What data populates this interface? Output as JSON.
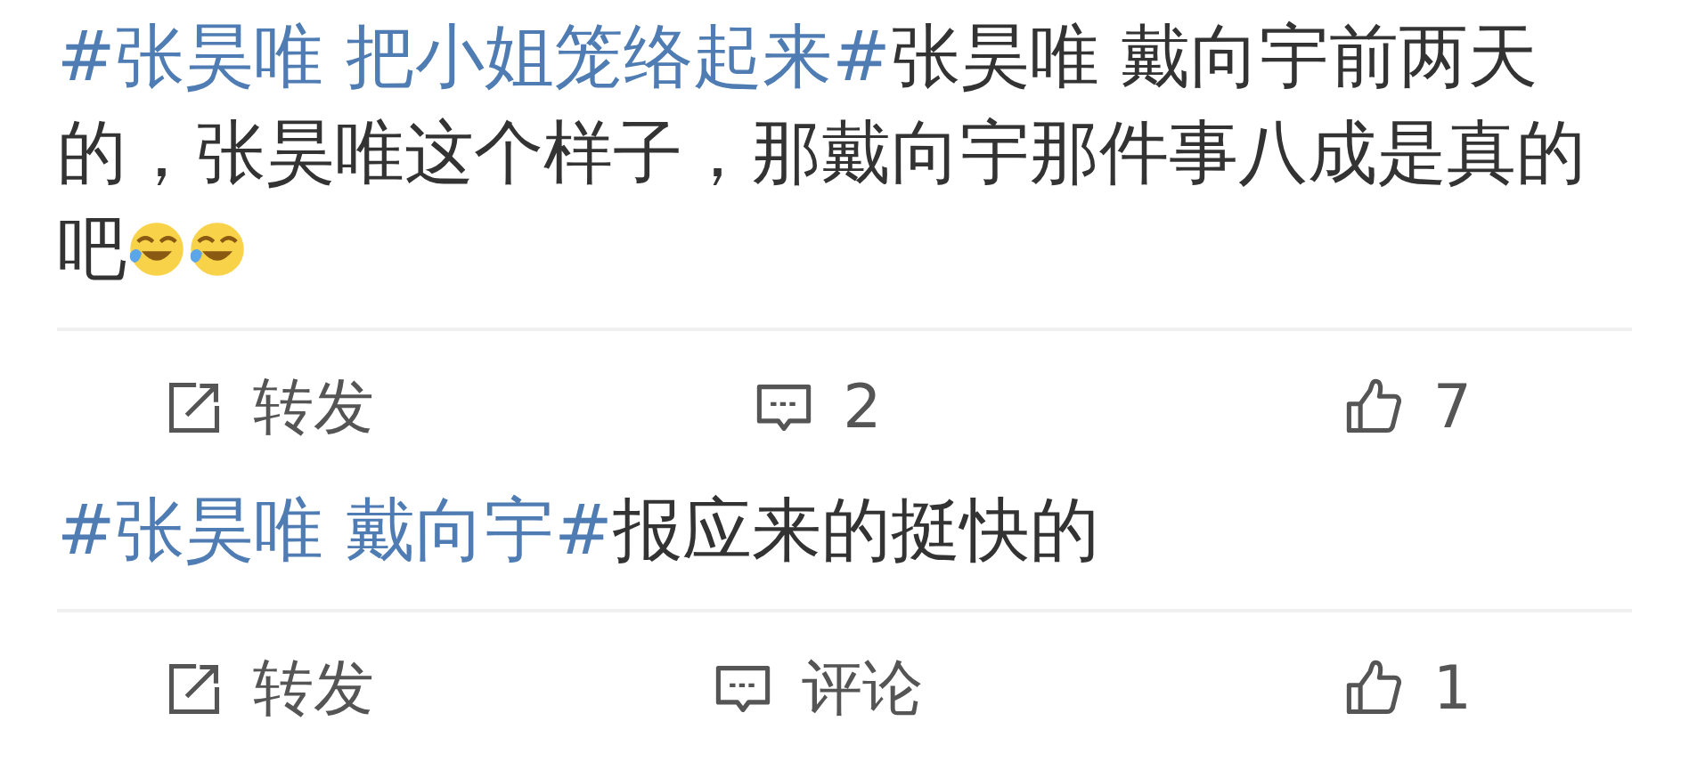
{
  "posts": [
    {
      "segments": [
        {
          "kind": "hashtag",
          "text": "#张昊唯 把小姐笼络起来#"
        },
        {
          "kind": "text",
          "text": "张昊唯 戴向宇前两天的，张昊唯这个样子，那戴向宇那件事八成是真的吧"
        }
      ],
      "emoji": [
        {
          "kind": "laugh-cry"
        },
        {
          "kind": "laugh-cry"
        }
      ],
      "actions": [
        {
          "kind": "repost",
          "label": "转发"
        },
        {
          "kind": "comment",
          "label": "2"
        },
        {
          "kind": "like",
          "label": "7"
        }
      ]
    },
    {
      "segments": [
        {
          "kind": "hashtag",
          "text": "#张昊唯 戴向宇#"
        },
        {
          "kind": "text",
          "text": "报应来的挺快的"
        }
      ],
      "actions": [
        {
          "kind": "repost",
          "label": "转发"
        },
        {
          "kind": "comment",
          "label": "评论"
        },
        {
          "kind": "like",
          "label": "1"
        }
      ]
    }
  ]
}
